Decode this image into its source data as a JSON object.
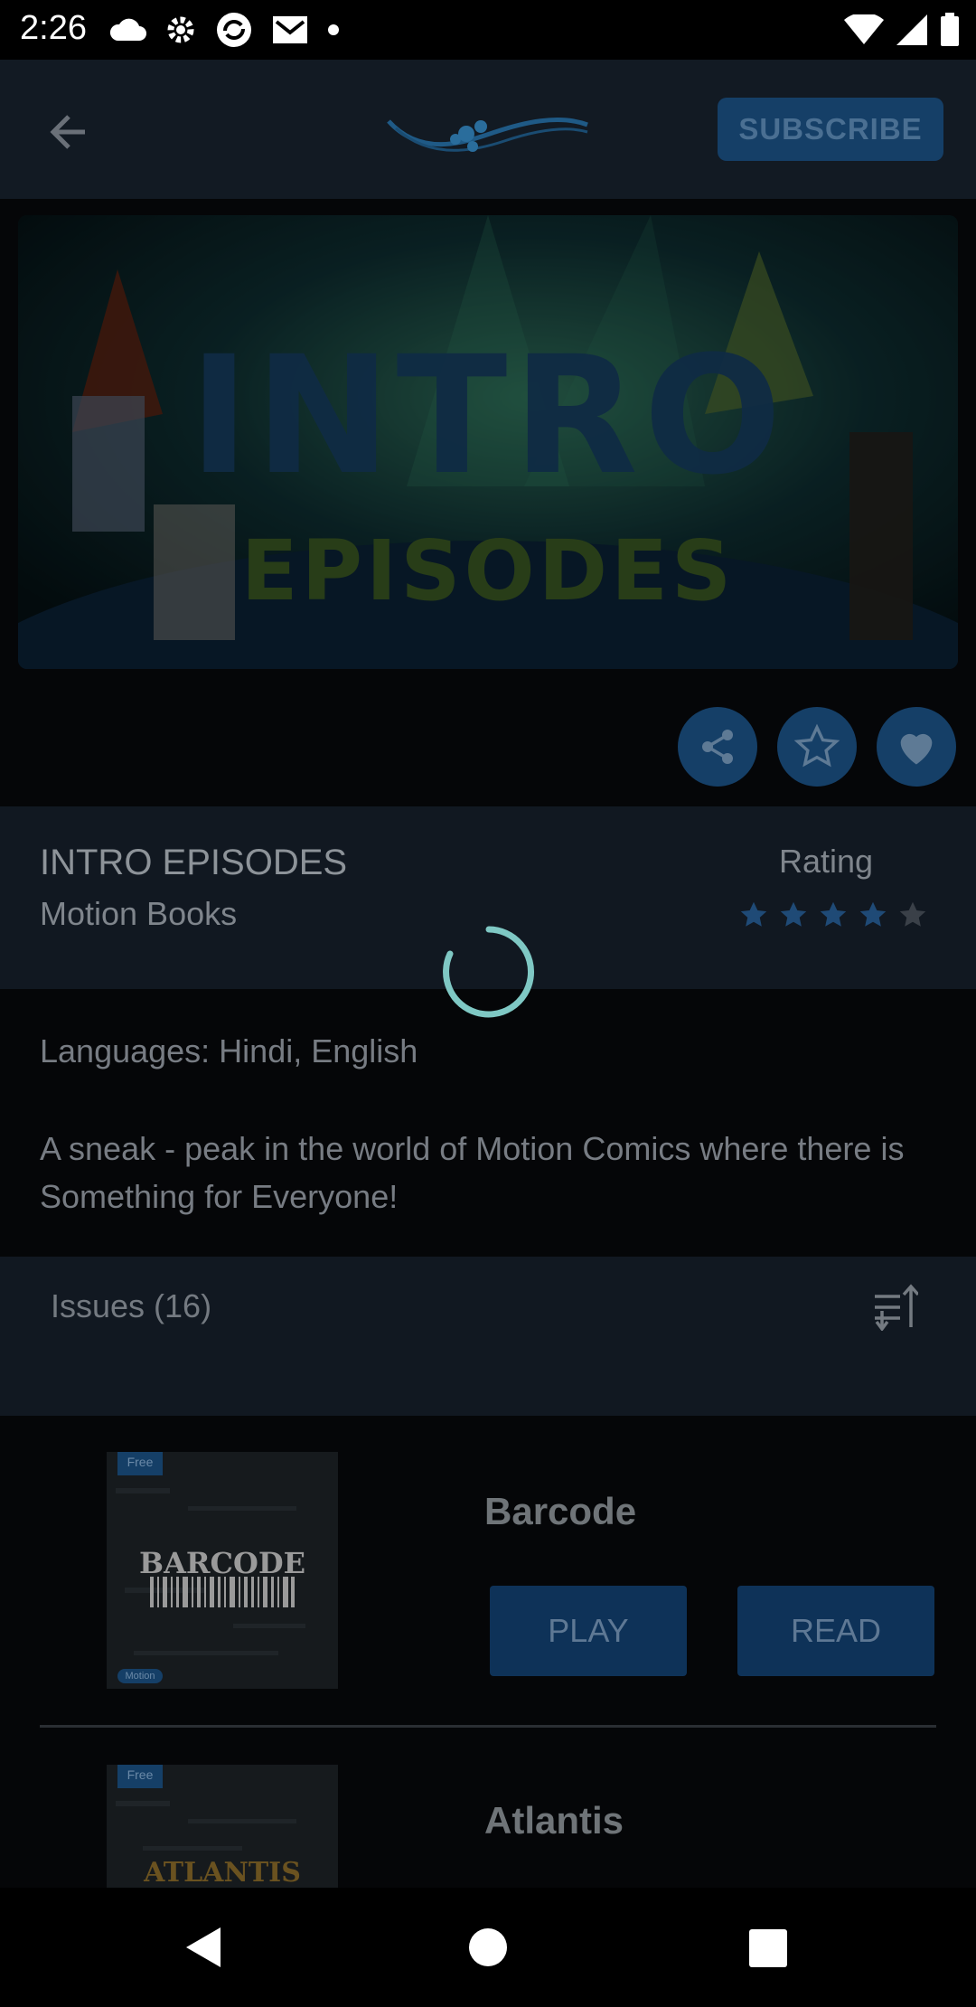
{
  "status_bar": {
    "time": "2:26"
  },
  "header": {
    "subscribe_label": "SUBSCRIBE"
  },
  "banner": {
    "title_line1": "INTRO",
    "title_line2": "EPISODES"
  },
  "actions": {
    "share": "share-icon",
    "favorite": "star-icon",
    "like": "heart-icon"
  },
  "series": {
    "title": "INTRO EPISODES",
    "publisher": "Motion Books",
    "rating_label": "Rating",
    "rating_value": 4,
    "rating_max": 5
  },
  "details": {
    "languages": "Languages: Hindi, English",
    "description": "A sneak - peak in the world of Motion Comics where there is Something for Everyone!"
  },
  "issues": {
    "label": "Issues (16)",
    "items": [
      {
        "title": "Barcode",
        "badge": "Free",
        "cover_text": "BARCODE",
        "cover_tag": "Motion",
        "play_label": "PLAY",
        "read_label": "READ"
      },
      {
        "title": "Atlantis",
        "badge": "Free",
        "cover_text": "ATLANTIS"
      }
    ]
  },
  "colors": {
    "accent": "#153f67",
    "overlay_bg": "#050608",
    "spinner": "#7fc8c4"
  }
}
